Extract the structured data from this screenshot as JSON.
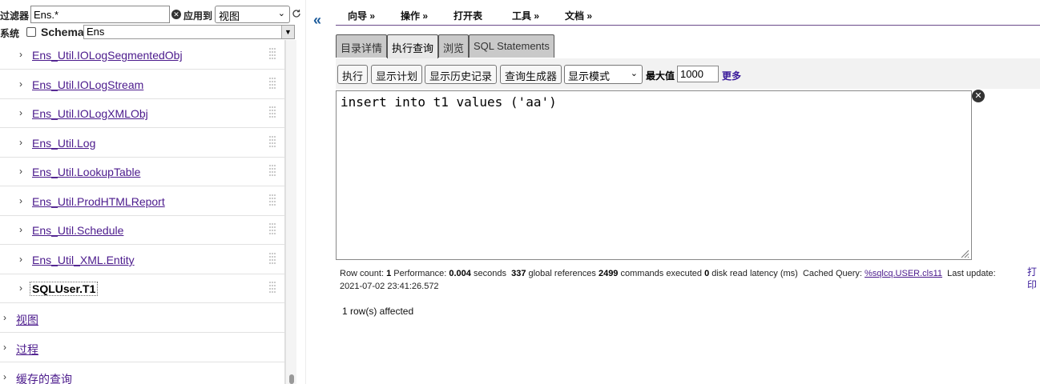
{
  "filter": {
    "label": "过滤器",
    "value": "Ens.*",
    "apply_label": "应用到",
    "apply_value": "视图"
  },
  "schema": {
    "system_label": "系统",
    "schema_label": "Schema",
    "value": "Ens"
  },
  "tree": {
    "items": [
      {
        "label": "Ens_Util.IOLogSegmentedObj"
      },
      {
        "label": "Ens_Util.IOLogStream"
      },
      {
        "label": "Ens_Util.IOLogXMLObj"
      },
      {
        "label": "Ens_Util.Log"
      },
      {
        "label": "Ens_Util.LookupTable"
      },
      {
        "label": "Ens_Util.ProdHTMLReport"
      },
      {
        "label": "Ens_Util.Schedule"
      },
      {
        "label": "Ens_Util_XML.Entity"
      },
      {
        "label": "SQLUser.T1"
      }
    ],
    "sections": [
      {
        "label": "视图"
      },
      {
        "label": "过程"
      },
      {
        "label": "缓存的查询"
      }
    ]
  },
  "menu": {
    "items": [
      {
        "label": "向导 »"
      },
      {
        "label": "操作 »"
      },
      {
        "label": "打开表"
      },
      {
        "label": "工具 »"
      },
      {
        "label": "文档 »"
      }
    ]
  },
  "tabs": [
    {
      "label": "目录详情"
    },
    {
      "label": "执行查询"
    },
    {
      "label": "浏览"
    },
    {
      "label": "SQL Statements"
    }
  ],
  "toolbar": {
    "execute": "执行",
    "show_plan": "显示计划",
    "show_history": "显示历史记录",
    "query_builder": "查询生成器",
    "display_mode": "显示模式",
    "max_label": "最大值",
    "max_value": "1000",
    "more": "更多"
  },
  "query": {
    "text": "insert into t1 values ('aa')"
  },
  "stats": {
    "row_count_label": "Row count:",
    "row_count": "1",
    "performance_label": "Performance:",
    "performance": "0.004",
    "seconds_label": "seconds",
    "global_refs": "337",
    "global_refs_label": "global references",
    "commands": "2499",
    "commands_label": "commands executed",
    "disk_latency": "0",
    "disk_latency_label": "disk read latency (ms)",
    "cached_query_label": "Cached Query:",
    "cached_query": "%sqlcq.USER.cls11",
    "last_update_label": "Last update:",
    "last_update": "2021-07-02 23:41:26.572",
    "print": "打印"
  },
  "result": {
    "affected": "1 row(s) affected"
  }
}
